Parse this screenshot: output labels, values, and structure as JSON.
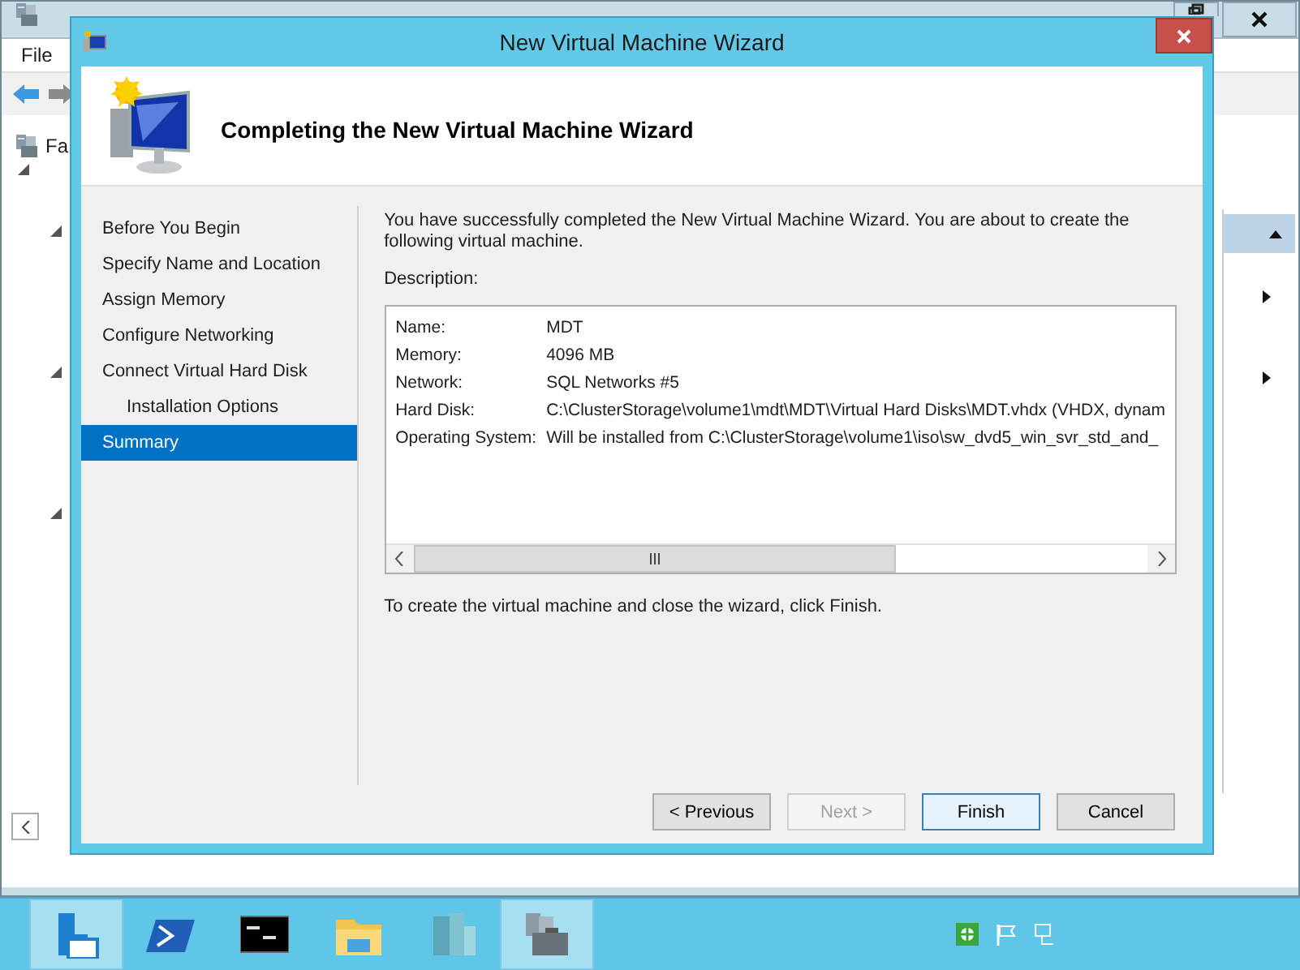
{
  "background_window": {
    "menu": [
      "File"
    ],
    "tree_items": [
      {
        "label": "Fa"
      }
    ]
  },
  "wizard": {
    "title": "New Virtual Machine Wizard",
    "heading": "Completing the New Virtual Machine Wizard",
    "steps": [
      {
        "label": "Before You Begin",
        "selected": false
      },
      {
        "label": "Specify Name and Location",
        "selected": false
      },
      {
        "label": "Assign Memory",
        "selected": false
      },
      {
        "label": "Configure Networking",
        "selected": false
      },
      {
        "label": "Connect Virtual Hard Disk",
        "selected": false,
        "children": [
          {
            "label": "Installation Options",
            "selected": false
          }
        ]
      },
      {
        "label": "Summary",
        "selected": true
      }
    ],
    "intro": "You have successfully completed the New Virtual Machine Wizard. You are about to create the following virtual machine.",
    "description_label": "Description:",
    "details": [
      {
        "name": "Name:",
        "value": "MDT"
      },
      {
        "name": "Memory:",
        "value": "4096 MB"
      },
      {
        "name": "Network:",
        "value": "SQL Networks #5"
      },
      {
        "name": "Hard Disk:",
        "value": "C:\\ClusterStorage\\volume1\\mdt\\MDT\\Virtual Hard Disks\\MDT.vhdx (VHDX, dynam"
      },
      {
        "name": "Operating System:",
        "value": "Will be installed from C:\\ClusterStorage\\volume1\\iso\\sw_dvd5_win_svr_std_and_"
      }
    ],
    "outro": "To create the virtual machine and close the wizard, click Finish.",
    "buttons": [
      {
        "label": "< Previous",
        "disabled": false,
        "default": false
      },
      {
        "label": "Next >",
        "disabled": true,
        "default": false
      },
      {
        "label": "Finish",
        "disabled": false,
        "default": true
      },
      {
        "label": "Cancel",
        "disabled": false,
        "default": false
      }
    ]
  },
  "taskbar": {
    "items": [
      {
        "kind": "server",
        "selected": true
      },
      {
        "kind": "powershell",
        "selected": false
      },
      {
        "kind": "console",
        "selected": false
      },
      {
        "kind": "folder",
        "selected": false
      },
      {
        "kind": "buildings",
        "selected": false
      },
      {
        "kind": "cluster",
        "selected": true
      }
    ],
    "tray": [
      {
        "kind": "shield"
      },
      {
        "kind": "flag"
      },
      {
        "kind": "network"
      }
    ]
  }
}
